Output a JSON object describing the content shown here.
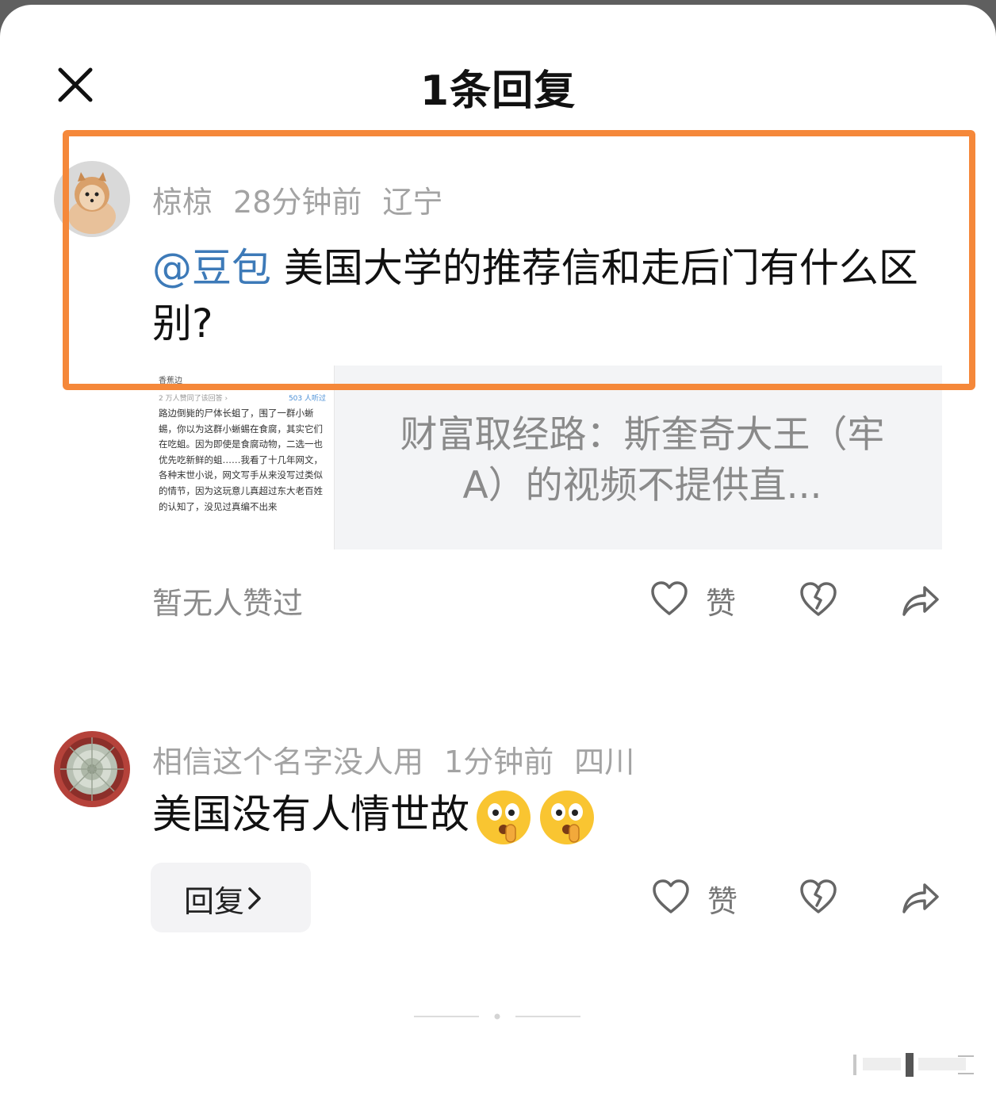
{
  "header": {
    "title": "1条回复",
    "close_icon": "close-icon"
  },
  "comments": [
    {
      "user": "椋椋",
      "time": "28分钟前",
      "location": "辽宁",
      "mention": "@豆包",
      "text": " 美国大学的推荐信和走后门有什么区别?",
      "preview": {
        "thumb_name": "香蕉边",
        "thumb_sub_left": "2 万人赞同了该回答 ›",
        "thumb_sub_right": "503 人听过",
        "thumb_text": "路边倒毙的尸体长蛆了，围了一群小蜥蜴，你以为这群小蜥蜴在食腐，其实它们在吃蛆。因为即使是食腐动物，二选一也优先吃新鲜的蛆……我看了十几年网文，各种末世小说，网文写手从来没写过类似的情节，因为这玩意儿真超过东大老百姓的认知了，没见过真编不出来",
        "title": "财富取经路：斯奎奇大王（牢 A）的视频不提供直..."
      },
      "likes_text": "暂无人赞过",
      "like_label": "赞"
    },
    {
      "user": "相信这个名字没人用",
      "time": "1分钟前",
      "location": "四川",
      "text": "美国没有人情世故",
      "emojis": [
        "shush-emoji",
        "shush-emoji"
      ],
      "reply_label": "回复",
      "like_label": "赞"
    }
  ],
  "colors": {
    "highlight_border": "#f5883a",
    "mention": "#3d7ab8",
    "meta": "#a3a3a3"
  }
}
